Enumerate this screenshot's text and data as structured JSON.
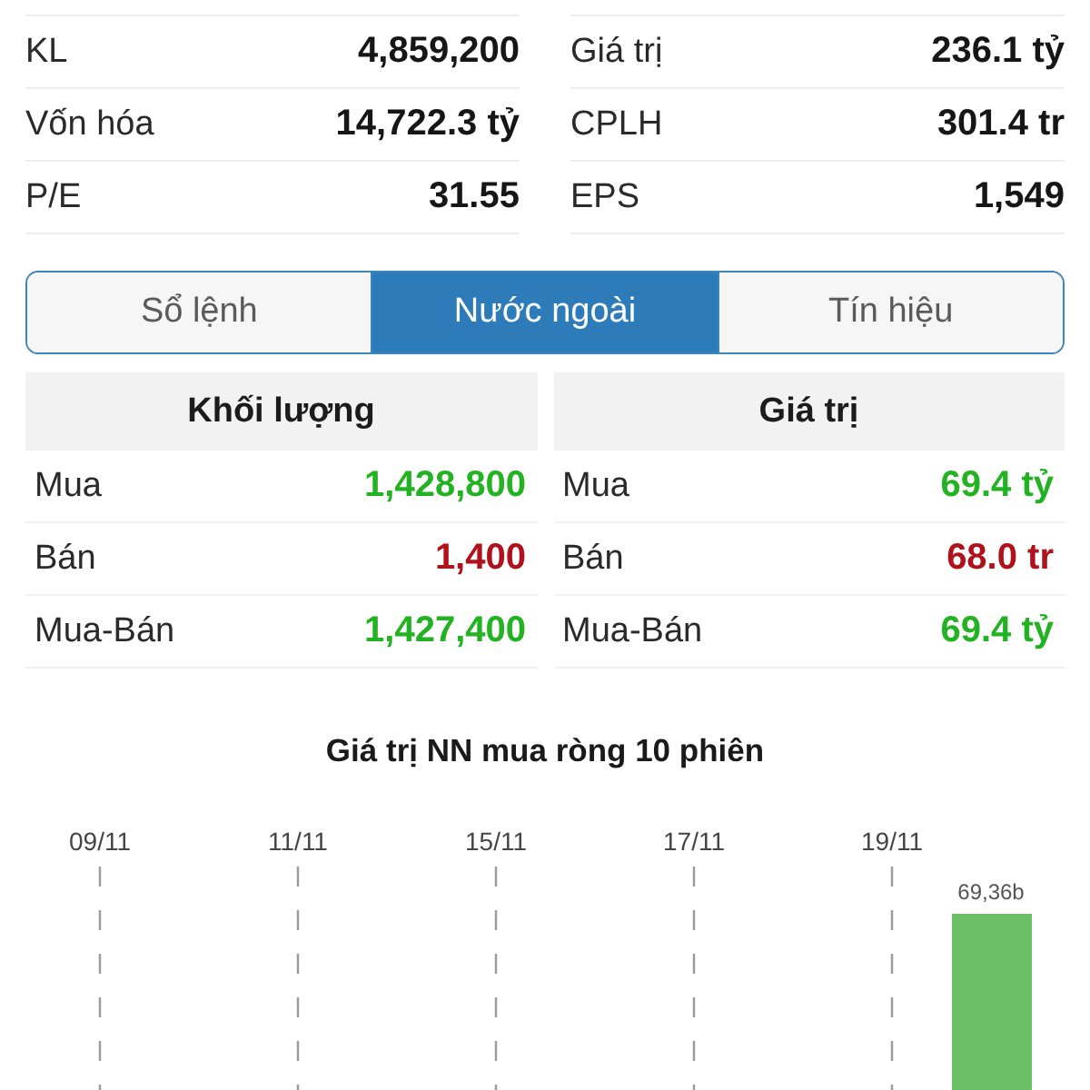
{
  "stats": [
    {
      "label": "KL",
      "value": "4,859,200"
    },
    {
      "label": "Giá trị",
      "value": "236.1 tỷ"
    },
    {
      "label": "Vốn hóa",
      "value": "14,722.3 tỷ"
    },
    {
      "label": "CPLH",
      "value": "301.4 tr"
    },
    {
      "label": "P/E",
      "value": "31.55"
    },
    {
      "label": "EPS",
      "value": "1,549"
    }
  ],
  "tabs": [
    {
      "label": "Sổ lệnh",
      "selected": false
    },
    {
      "label": "Nước ngoài",
      "selected": true
    },
    {
      "label": "Tín hiệu",
      "selected": false
    }
  ],
  "foreign_trade": [
    {
      "header": "Khối lượng",
      "rows": [
        {
          "label": "Mua",
          "value": "1,428,800",
          "color": "#22b222"
        },
        {
          "label": "Bán",
          "value": "1,400",
          "color": "#b0111b"
        },
        {
          "label": "Mua-Bán",
          "value": "1,427,400",
          "color": "#22b222"
        }
      ]
    },
    {
      "header": "Giá trị",
      "rows": [
        {
          "label": "Mua",
          "value": "69.4 tỷ",
          "color": "#22b222"
        },
        {
          "label": "Bán",
          "value": "68.0 tr",
          "color": "#b0111b"
        },
        {
          "label": "Mua-Bán",
          "value": "69.4 tỷ",
          "color": "#22b222"
        }
      ]
    }
  ],
  "chart": {
    "title": "Giá trị NN mua ròng 10 phiên",
    "date_labels": [
      "09/11",
      "11/11",
      "15/11",
      "17/11",
      "19/11"
    ],
    "bar_label": "69,36b"
  }
}
